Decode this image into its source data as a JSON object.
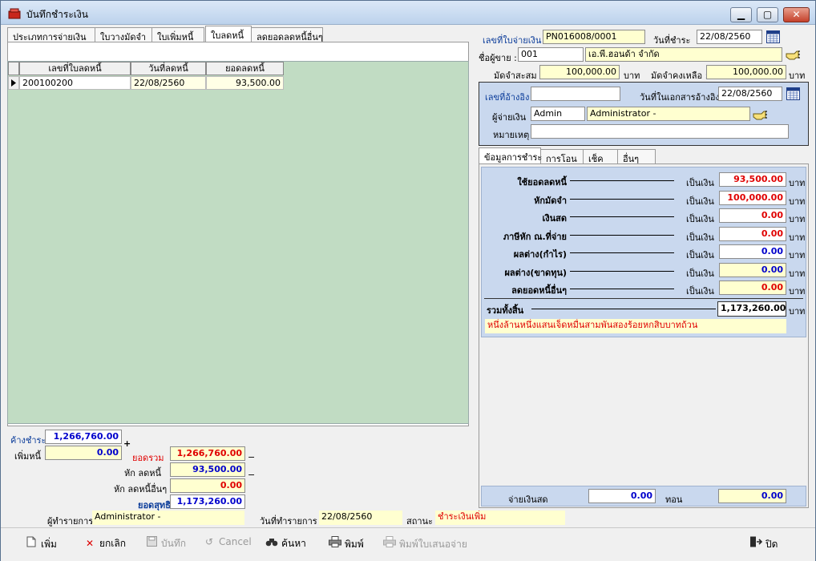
{
  "window": {
    "title": "บันทึกชำระเงิน",
    "minimize": "▁",
    "maximize": "▢",
    "close": "✕"
  },
  "left_tabs": [
    "ประเภทการจ่ายเงิน",
    "ใบวางมัดจำ",
    "ใบเพิ่มหนี้",
    "ใบลดหนี้",
    "ลดยอดลดหนี้อื่นๆ"
  ],
  "grid": {
    "headers": [
      "เลขที่ใบลดหนี้",
      "วันที่ลดหนี้",
      "ยอดลดหนี้"
    ],
    "rows": [
      {
        "doc_no": "200100200",
        "date": "22/08/2560",
        "amount": "93,500.00"
      }
    ]
  },
  "header": {
    "doc_no_label": "เลขที่ใบจ่ายเงิน",
    "doc_no": "PN016008/0001",
    "pay_date_label": "วันที่ชำระ",
    "pay_date": "22/08/2560",
    "vendor_label": "ชื่อผู้ขาย :",
    "vendor_code": "001",
    "vendor_name": "เอ.พี.ฮอนด้า จำกัด",
    "deposit_accum_label": "มัดจำสะสม :",
    "deposit_accum": "100,000.00",
    "baht1": "บาท",
    "deposit_remain_label": "มัดจำคงเหลือ :",
    "deposit_remain": "100,000.00",
    "baht2": "บาท"
  },
  "ref_panel": {
    "ref_no_label": "เลขที่อ้างอิง",
    "ref_no": "",
    "ref_date_label": "วันที่ในเอกสารอ้างอิง",
    "ref_date": "22/08/2560",
    "payer_label": "ผู้จ่ายเงิน",
    "payer_code": "Admin",
    "payer_name": "Administrator -",
    "note_label": "หมายเหตุ",
    "note": ""
  },
  "right_tabs": [
    "ข้อมูลการชำระ",
    "การโอน",
    "เช็ค",
    "อื่นๆ"
  ],
  "payment": {
    "currency_label": "เป็นเงิน",
    "baht": "บาท",
    "rows": [
      {
        "label": "ใช้ยอดลดหนี้",
        "value": "93,500.00"
      },
      {
        "label": "หักมัดจำ",
        "value": "100,000.00"
      },
      {
        "label": "เงินสด",
        "value": "0.00"
      },
      {
        "label": "ภาษีหัก ณ.ที่จ่าย",
        "value": "0.00"
      },
      {
        "label": "ผลต่าง(กำไร)",
        "value": "0.00"
      },
      {
        "label": "ผลต่าง(ขาดทุน)",
        "value": "0.00"
      },
      {
        "label": "ลดยอดหนี้อื่นๆ",
        "value": "0.00"
      }
    ],
    "total_label": "รวมทั้งสิ้น",
    "total": "1,173,260.00",
    "total_text": "หนึ่งล้านหนึ่งแสนเจ็ดหมื่นสามพันสองร้อยหกสิบบาทถ้วน"
  },
  "cash_row": {
    "pay_cash_label": "จ่ายเงินสด",
    "pay_cash": "0.00",
    "change_label": "ทอน",
    "change": "0.00"
  },
  "summary": {
    "outstanding_label": "ค้างชำระ",
    "outstanding": "1,266,760.00",
    "plus": "+",
    "add_debt_label": "เพิ่มหนี้",
    "add_debt": "0.00",
    "total_label": "ยอดรวม",
    "total": "1,266,760.00",
    "less_credit_label": "หัก ลดหนี้",
    "less_credit": "93,500.00",
    "less_other_label": "หัก ลดหนี้อื่นๆ",
    "less_other": "0.00",
    "net_label": "ยอดสุทธิ",
    "net": "1,173,260.00",
    "minus": "−"
  },
  "footer": {
    "operator_label": "ผู้ทำรายการ",
    "operator": "Administrator -",
    "op_date_label": "วันที่ทำรายการ",
    "op_date": "22/08/2560",
    "status_label": "สถานะ",
    "status": "ชำระเงินเพิ่ม"
  },
  "toolbar": {
    "add": "เพิ่ม",
    "cancel_doc": "ยกเลิก",
    "save": "บันทึก",
    "cancel": "Cancel",
    "search": "ค้นหา",
    "print": "พิมพ์",
    "print_bill": "พิมพ์ใบเสนอจ่าย",
    "close": "ปิด"
  }
}
